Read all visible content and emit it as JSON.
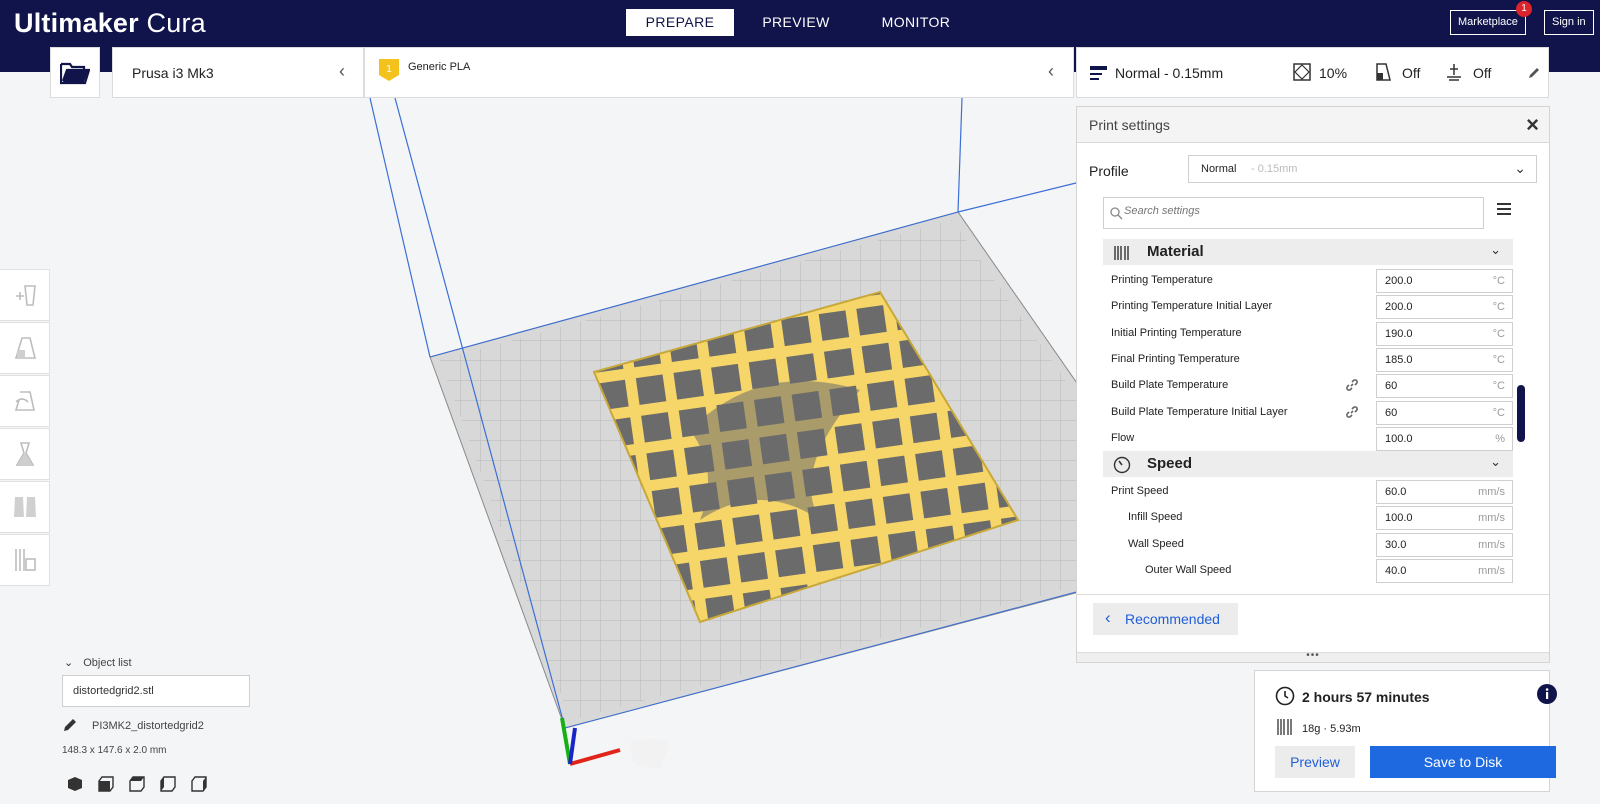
{
  "app": {
    "name_bold": "Ultimaker",
    "name_light": " Cura"
  },
  "stages": [
    {
      "label": "PREPARE",
      "active": true
    },
    {
      "label": "PREVIEW",
      "active": false
    },
    {
      "label": "MONITOR",
      "active": false
    }
  ],
  "account": {
    "marketplace_label": "Marketplace",
    "marketplace_badge": "1",
    "signin_label": "Sign in"
  },
  "header": {
    "printer": "Prusa i3 Mk3",
    "material": "Generic PLA",
    "material_badge": "1",
    "profile_summary": "Normal - 0.15mm",
    "infill": "10%",
    "support": "Off",
    "adhesion": "Off"
  },
  "print_settings": {
    "title": "Print settings",
    "profile_label": "Profile",
    "profile_name": "Normal",
    "profile_detail": "- 0.15mm",
    "search_placeholder": "Search settings",
    "categories": [
      {
        "label": "Material",
        "icon": "material-spool-icon",
        "settings": [
          {
            "label": "Printing Temperature",
            "value": "200.0",
            "unit": "°C",
            "indent": 0,
            "linked": false
          },
          {
            "label": "Printing Temperature Initial Layer",
            "value": "200.0",
            "unit": "°C",
            "indent": 0,
            "linked": false
          },
          {
            "label": "Initial Printing Temperature",
            "value": "190.0",
            "unit": "°C",
            "indent": 0,
            "linked": false
          },
          {
            "label": "Final Printing Temperature",
            "value": "185.0",
            "unit": "°C",
            "indent": 0,
            "linked": false
          },
          {
            "label": "Build Plate Temperature",
            "value": "60",
            "unit": "°C",
            "indent": 0,
            "linked": true
          },
          {
            "label": "Build Plate Temperature Initial Layer",
            "value": "60",
            "unit": "°C",
            "indent": 0,
            "linked": true
          },
          {
            "label": "Flow",
            "value": "100.0",
            "unit": "%",
            "indent": 0,
            "linked": false
          }
        ]
      },
      {
        "label": "Speed",
        "icon": "speed-gauge-icon",
        "settings": [
          {
            "label": "Print Speed",
            "value": "60.0",
            "unit": "mm/s",
            "indent": 0,
            "linked": false
          },
          {
            "label": "Infill Speed",
            "value": "100.0",
            "unit": "mm/s",
            "indent": 1,
            "linked": false
          },
          {
            "label": "Wall Speed",
            "value": "30.0",
            "unit": "mm/s",
            "indent": 1,
            "linked": false
          },
          {
            "label": "Outer Wall Speed",
            "value": "40.0",
            "unit": "mm/s",
            "indent": 2,
            "linked": false
          }
        ]
      }
    ],
    "recommended_label": "Recommended"
  },
  "object_list": {
    "toggle_label": "Object list",
    "file": "distortedgrid2.stl",
    "object_name": "PI3MK2_distortedgrid2",
    "dimensions": "148.3 x 147.6 x 2.0 mm"
  },
  "job": {
    "time": "2 hours 57 minutes",
    "material_usage": "18g · 5.93m",
    "preview_label": "Preview",
    "save_label": "Save to Disk"
  },
  "colors": {
    "topbar": "#10144b",
    "accent": "#1f69e0",
    "model": "#f6d668",
    "model_edge": "#c8a838"
  },
  "icons": [
    "open-folder-icon",
    "move-tool-icon",
    "scale-tool-icon",
    "rotate-tool-icon",
    "mirror-tool-icon",
    "per-model-settings-icon",
    "support-blocker-icon",
    "layer-height-icon",
    "infill-icon",
    "support-icon",
    "adhesion-icon",
    "pencil-icon",
    "close-icon",
    "chevron-down-icon",
    "search-icon",
    "menu-icon",
    "link-icon",
    "clock-icon",
    "info-icon"
  ]
}
